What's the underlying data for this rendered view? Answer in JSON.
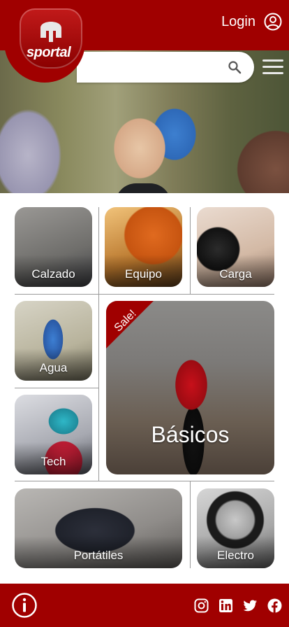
{
  "header": {
    "login_label": "Login",
    "brand": "sportal",
    "search": {
      "placeholder": ""
    }
  },
  "categories": {
    "calzado": "Calzado",
    "equipo": "Equipo",
    "carga": "Carga",
    "agua": "Agua",
    "tech": "Tech",
    "basicos": "Básicos",
    "portatiles": "Portátiles",
    "electro": "Electro"
  },
  "sale_badge": "Sale!",
  "colors": {
    "brand_red": "#a00000",
    "text": "#ffffff"
  },
  "icons": {
    "login": "user-circle-icon",
    "search": "search-icon",
    "menu": "hamburger-menu-icon",
    "info": "info-icon",
    "social": [
      "instagram-icon",
      "linkedin-icon",
      "twitter-icon",
      "facebook-icon"
    ]
  }
}
